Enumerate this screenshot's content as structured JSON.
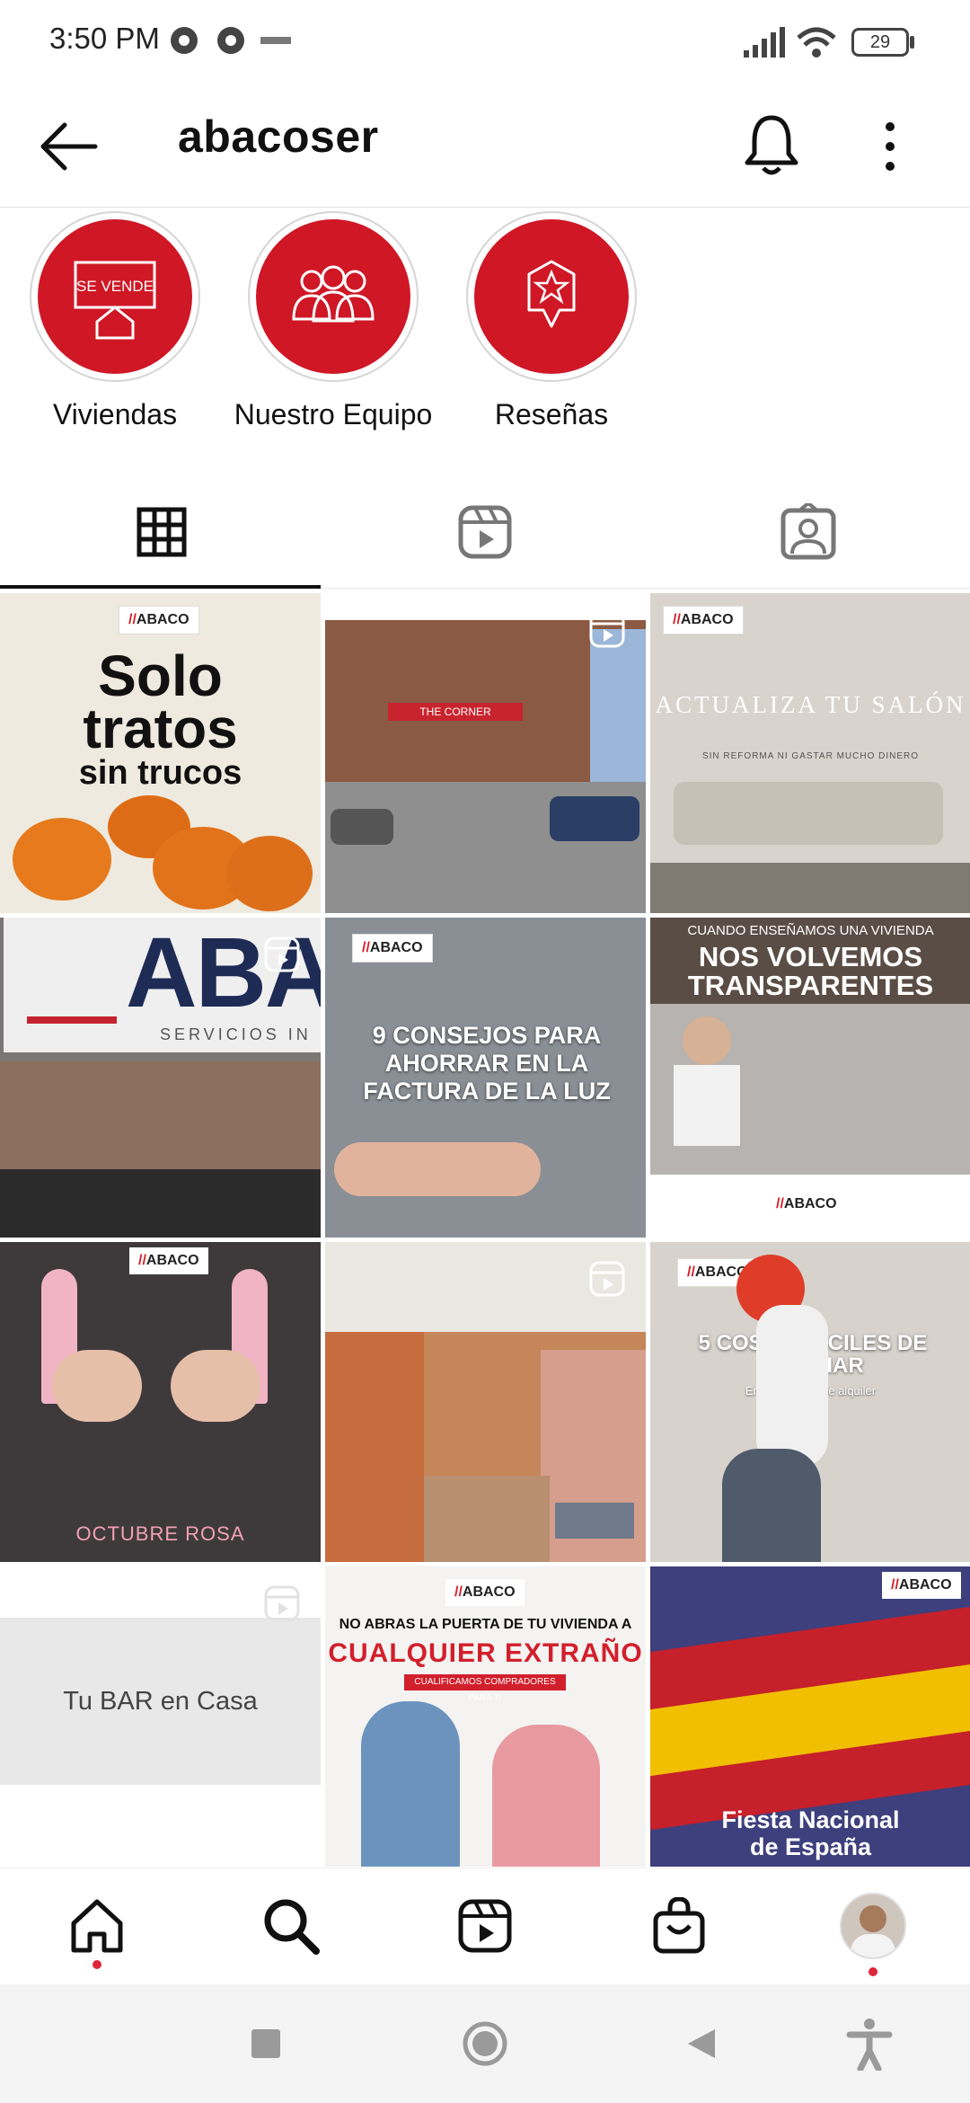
{
  "status": {
    "time": "3:50 PM",
    "battery": "29"
  },
  "header": {
    "title": "abacoser"
  },
  "highlights": [
    {
      "label": "Viviendas",
      "icon_text": "SE VENDE"
    },
    {
      "label": "Nuestro Equipo"
    },
    {
      "label": "Reseñas"
    }
  ],
  "tabs": [
    {
      "name": "grid"
    },
    {
      "name": "reels"
    },
    {
      "name": "tagged"
    }
  ],
  "posts": {
    "logo": "ABACO",
    "p1": {
      "line1": "Solo",
      "line2": "tratos",
      "line3": "sin trucos"
    },
    "p2": {
      "sign": "THE CORNER"
    },
    "p3": {
      "title": "ACTUALIZA TU SALÓN",
      "sub": "SIN REFORMA NI GASTAR MUCHO DINERO"
    },
    "p4": {
      "text": "ABA",
      "sub": "SERVICIOS IN"
    },
    "p5": {
      "title": "9 CONSEJOS PARA AHORRAR EN LA FACTURA DE LA LUZ"
    },
    "p6": {
      "top": "CUANDO ENSEÑAMOS UNA VIVIENDA",
      "title1": "NOS VOLVEMOS",
      "title2": "TRANSPARENTES"
    },
    "p7": {
      "caption": "OCTUBRE ROSA"
    },
    "p9": {
      "title": "5 COSAS FÁCILES DE CAMBIAR",
      "sub": "En tu vivienda de alquiler"
    },
    "p10": {
      "text": "Tu BAR en Casa"
    },
    "p11": {
      "line1": "NO ABRAS LA PUERTA DE TU VIVIENDA A",
      "line2": "CUALQUIER EXTRAÑO",
      "line3": "CUALIFICAMOS COMPRADORES PARA TI"
    },
    "p12": {
      "line1": "Fiesta Nacional",
      "line2": "de España"
    }
  },
  "colors": {
    "accent": "#cf1726",
    "notify_dot": "#e0243a"
  }
}
